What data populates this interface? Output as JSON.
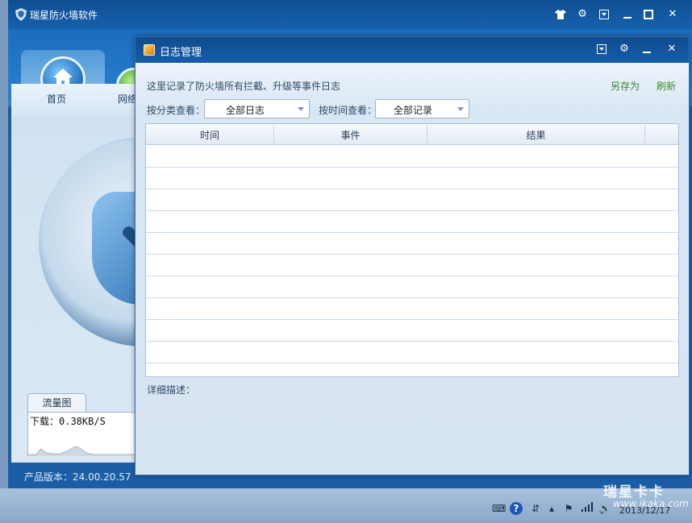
{
  "app": {
    "title": "瑞星防火墙软件",
    "nav": {
      "home_label": "首页",
      "network_label": "网络"
    },
    "version_label": "产品版本：24.00.20.57",
    "traffic": {
      "tab_label": "流量图",
      "download": "下载：0.38KB/S"
    }
  },
  "dialog": {
    "title": "日志管理",
    "description": "这里记录了防火墙所有拦截、升级等事件日志",
    "save_as": "另存为",
    "refresh": "刷新",
    "filter_category_label": "按分类查看：",
    "filter_category_value": "全部日志",
    "filter_time_label": "按时间查看：",
    "filter_time_value": "全部记录",
    "columns": [
      "时间",
      "事件",
      "结果"
    ],
    "rows": [],
    "detail_label": "详细描述："
  },
  "taskbar": {
    "date": "2013/12/17"
  },
  "watermark": {
    "brand": "瑞星卡卡",
    "url": "www.ikaka.com"
  },
  "colors": {
    "titlebar": "#0e4c8e",
    "link": "#3b8a2e",
    "dialog_bg": "#d7e4f2"
  }
}
